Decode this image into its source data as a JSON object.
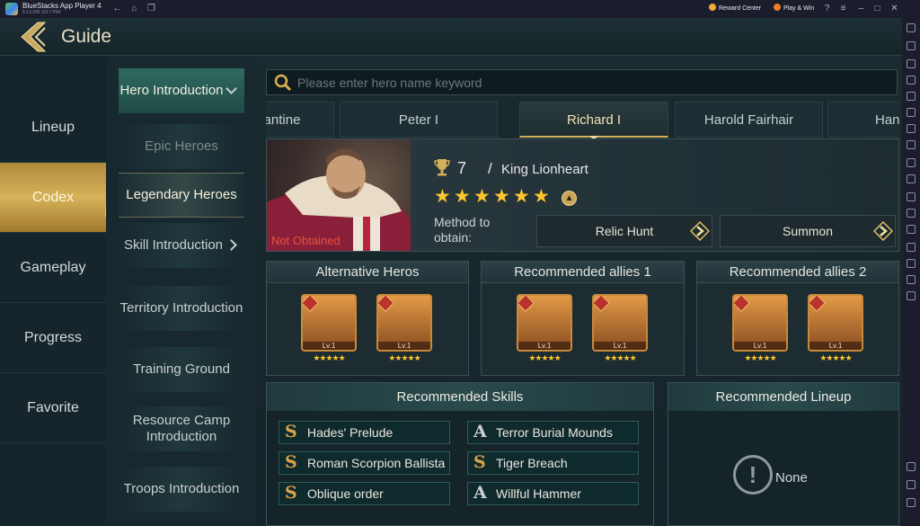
{
  "titlebar": {
    "app_name": "BlueStacks App Player 4",
    "version": "5.13.200.1017 P64",
    "reward_center": "Reward Center",
    "play_win": "Play & Win"
  },
  "header": {
    "title": "Guide"
  },
  "left_nav": {
    "items": [
      {
        "label": "Lineup"
      },
      {
        "label": "Codex"
      },
      {
        "label": "Gameplay"
      },
      {
        "label": "Progress"
      },
      {
        "label": "Favorite"
      }
    ],
    "active_index": 1
  },
  "sub_nav": {
    "items": [
      {
        "label": "Hero Introduction"
      },
      {
        "label": "Epic Heroes"
      },
      {
        "label": "Legendary Heroes"
      },
      {
        "label": "Skill Introduction"
      },
      {
        "label": "Territory Introduction"
      },
      {
        "label": "Training Ground"
      },
      {
        "label": "Resource Camp Introduction"
      },
      {
        "label": "Troops Introduction"
      }
    ]
  },
  "search": {
    "placeholder": "Please enter hero name keyword",
    "value": ""
  },
  "hero_tabs": [
    {
      "label": "nstantine"
    },
    {
      "label": "Peter I"
    },
    {
      "label": "Richard I"
    },
    {
      "label": "Harold Fairhair"
    },
    {
      "label": "Han"
    }
  ],
  "active_hero_tab": 2,
  "hero": {
    "status": "Not Obtained",
    "level": "7",
    "separator": "/",
    "title": "King Lionheart",
    "stars": 6,
    "method_label": "Method to obtain:",
    "methods": [
      {
        "label": "Relic Hunt"
      },
      {
        "label": "Summon"
      }
    ]
  },
  "panels": {
    "alternative": {
      "title": "Alternative Heros",
      "heroes": [
        {
          "level": "Lv.1",
          "stars": 5
        },
        {
          "level": "Lv.1",
          "stars": 5
        }
      ]
    },
    "allies1": {
      "title": "Recommended allies 1",
      "heroes": [
        {
          "level": "Lv.1",
          "stars": 5
        },
        {
          "level": "Lv.1",
          "stars": 5
        }
      ]
    },
    "allies2": {
      "title": "Recommended allies 2",
      "heroes": [
        {
          "level": "Lv.1",
          "stars": 5
        },
        {
          "level": "Lv.1",
          "stars": 5
        }
      ]
    }
  },
  "skills": {
    "title": "Recommended Skills",
    "items": [
      {
        "grade": "S",
        "name": "Hades' Prelude"
      },
      {
        "grade": "A",
        "name": "Terror Burial Mounds"
      },
      {
        "grade": "S",
        "name": "Roman Scorpion Ballista"
      },
      {
        "grade": "S",
        "name": "Tiger Breach"
      },
      {
        "grade": "S",
        "name": "Oblique order"
      },
      {
        "grade": "A",
        "name": "Willful Hammer"
      }
    ]
  },
  "lineup": {
    "title": "Recommended Lineup",
    "value": "None"
  },
  "colors": {
    "accent_gold": "#d3b05a",
    "star": "#ffc52e",
    "not_obtained": "#e5533e"
  }
}
